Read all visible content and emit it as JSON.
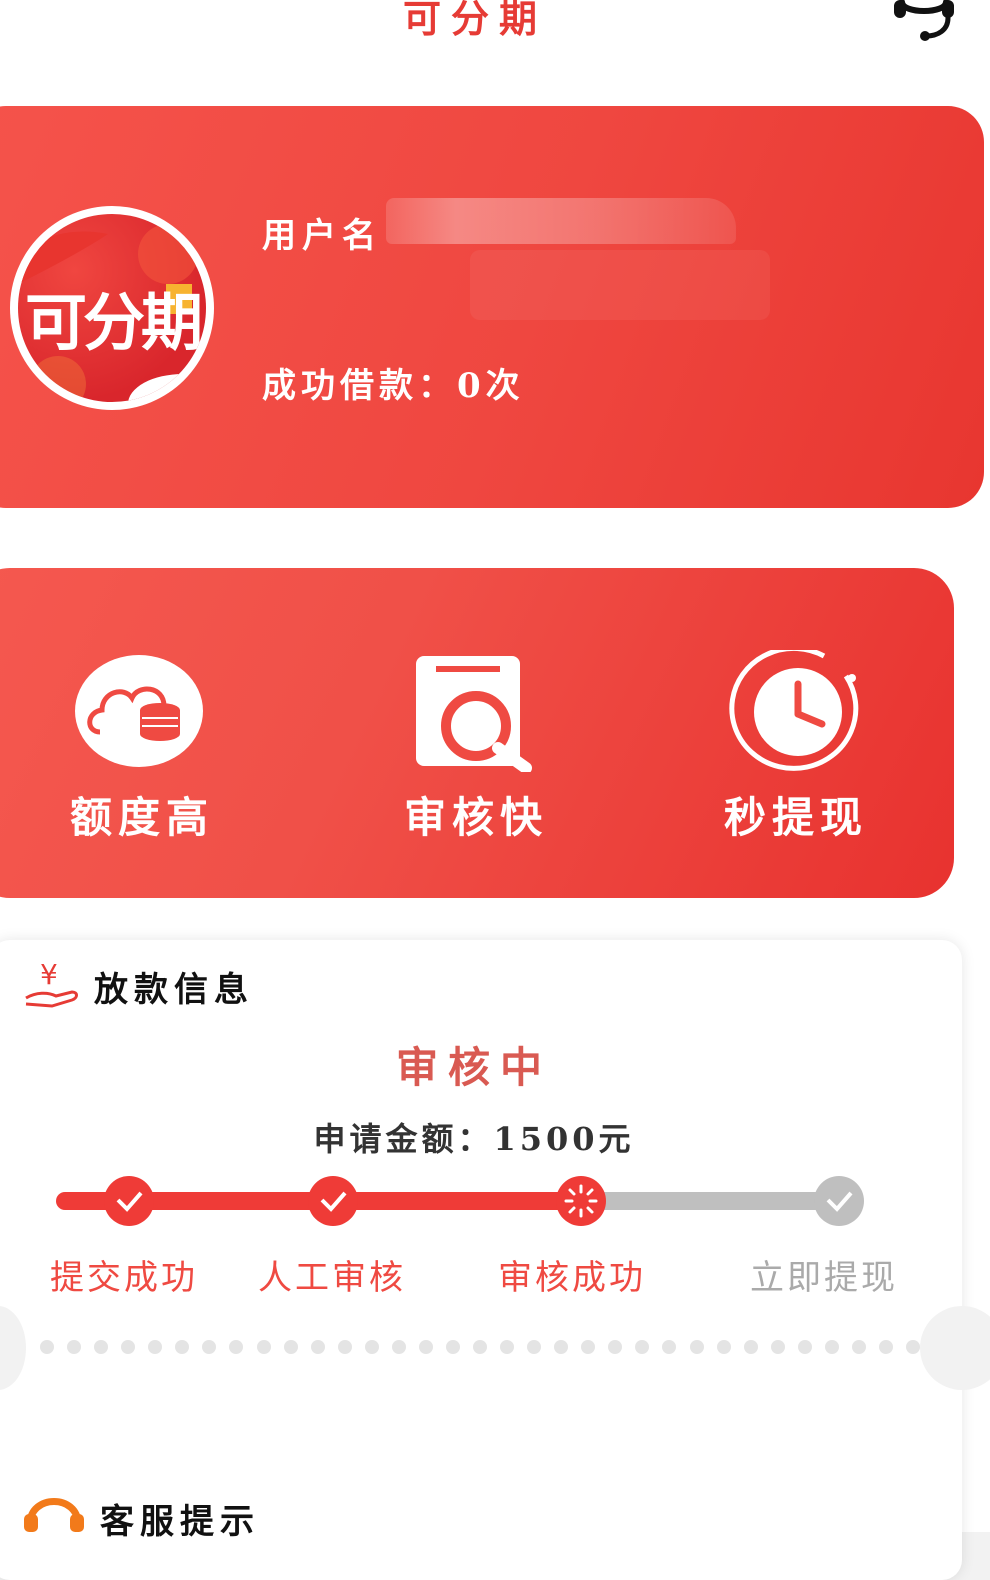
{
  "header": {
    "title": "可分期",
    "support_icon": "headset-icon"
  },
  "profile": {
    "avatar_text": "可分期",
    "username_label": "用户名",
    "loan_count": "成功借款：0次"
  },
  "features": [
    {
      "label": "额度高",
      "icon": "cloud-coins-icon"
    },
    {
      "label": "审核快",
      "icon": "document-search-icon"
    },
    {
      "label": "秒提现",
      "icon": "clock-icon"
    }
  ],
  "loan_info": {
    "title": "放款信息",
    "icon": "yen-hand-icon",
    "status": "审核中",
    "amount": "申请金额：1500元",
    "steps": [
      {
        "label": "提交成功",
        "state": "done"
      },
      {
        "label": "人工审核",
        "state": "done"
      },
      {
        "label": "审核成功",
        "state": "in-progress"
      },
      {
        "label": "立即提现",
        "state": "pending"
      }
    ]
  },
  "service": {
    "title": "客服提示",
    "icon": "headphones-icon"
  },
  "colors": {
    "accent": "#ef3b37",
    "pending": "#bfbfbf",
    "status": "#d95a52"
  }
}
